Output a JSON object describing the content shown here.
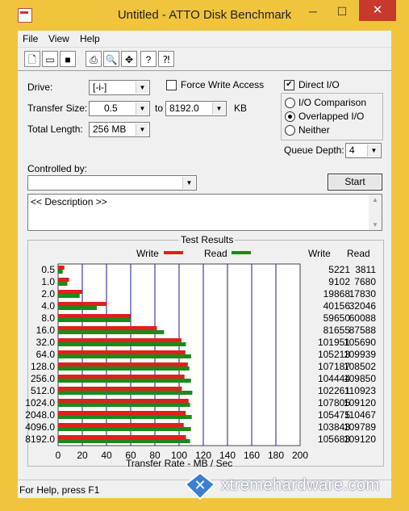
{
  "window": {
    "title": "Untitled - ATTO Disk Benchmark",
    "minimize": "─",
    "maximize": "☐",
    "close": "✕"
  },
  "menu": [
    "File",
    "View",
    "Help"
  ],
  "toolbar": [
    "new-file-icon",
    "open-folder-icon",
    "save-icon",
    "print-icon",
    "print-preview-icon",
    "move-icon",
    "help-icon",
    "context-help-icon"
  ],
  "form": {
    "drive_label": "Drive:",
    "drive_value": "[-i-]",
    "transfer_size_label": "Transfer Size:",
    "transfer_from": "0.5",
    "to_label": "to",
    "transfer_to": "8192.0",
    "kb_label": "KB",
    "total_length_label": "Total Length:",
    "total_length_value": "256 MB",
    "force_write_label": "Force Write Access",
    "force_write_checked": false,
    "direct_io_label": "Direct I/O",
    "direct_io_checked": true,
    "io_comparison_label": "I/O Comparison",
    "overlapped_io_label": "Overlapped I/O",
    "neither_label": "Neither",
    "selected_mode": "overlapped",
    "queue_depth_label": "Queue Depth:",
    "queue_depth_value": "4",
    "controlled_by_label": "Controlled by:",
    "controlled_by_value": "",
    "start_label": "Start",
    "description_text": "<< Description >>"
  },
  "results": {
    "title": "Test Results",
    "write_label": "Write",
    "read_label": "Read",
    "col_write": "Write",
    "col_read": "Read",
    "xlabel": "Transfer Rate - MB / Sec"
  },
  "colors": {
    "write": "#e0201c",
    "read": "#1a8a1a",
    "grid": "#1a1a8c",
    "chrome": "#f1c43e",
    "close": "#c7392b"
  },
  "chart_data": {
    "type": "bar",
    "orientation": "horizontal",
    "title": "Test Results",
    "xlabel": "Transfer Rate - MB / Sec",
    "xlim": [
      0,
      200
    ],
    "xticks": [
      "0",
      "20",
      "40",
      "60",
      "80",
      "100",
      "120",
      "140",
      "160",
      "180",
      "200"
    ],
    "categories": [
      "0.5",
      "1.0",
      "2.0",
      "4.0",
      "8.0",
      "16.0",
      "32.0",
      "64.0",
      "128.0",
      "256.0",
      "512.0",
      "1024.0",
      "2048.0",
      "4096.0",
      "8192.0"
    ],
    "series": [
      {
        "name": "Write",
        "values_kb": [
          "5221",
          "9102",
          "19868",
          "40156",
          "59650",
          "81655",
          "101951",
          "105213",
          "107187",
          "104444",
          "102261",
          "107805",
          "105475",
          "103843",
          "105683"
        ],
        "values": [
          5.221,
          9.102,
          19.868,
          40.156,
          59.65,
          81.655,
          101.951,
          105.213,
          107.187,
          104.444,
          102.261,
          107.805,
          105.475,
          103.843,
          105.683
        ]
      },
      {
        "name": "Read",
        "values_kb": [
          "3811",
          "7680",
          "17830",
          "32046",
          "60088",
          "87588",
          "105690",
          "109939",
          "108502",
          "109850",
          "110923",
          "109120",
          "110467",
          "109789",
          "109120"
        ],
        "values": [
          3.811,
          7.68,
          17.83,
          32.046,
          60.088,
          87.588,
          105.69,
          109.939,
          108.502,
          109.85,
          110.923,
          109.12,
          110.467,
          109.789,
          109.12
        ]
      }
    ]
  },
  "status": {
    "text": "For Help, press F1"
  },
  "watermark": {
    "text": "xtremehardware.com"
  }
}
